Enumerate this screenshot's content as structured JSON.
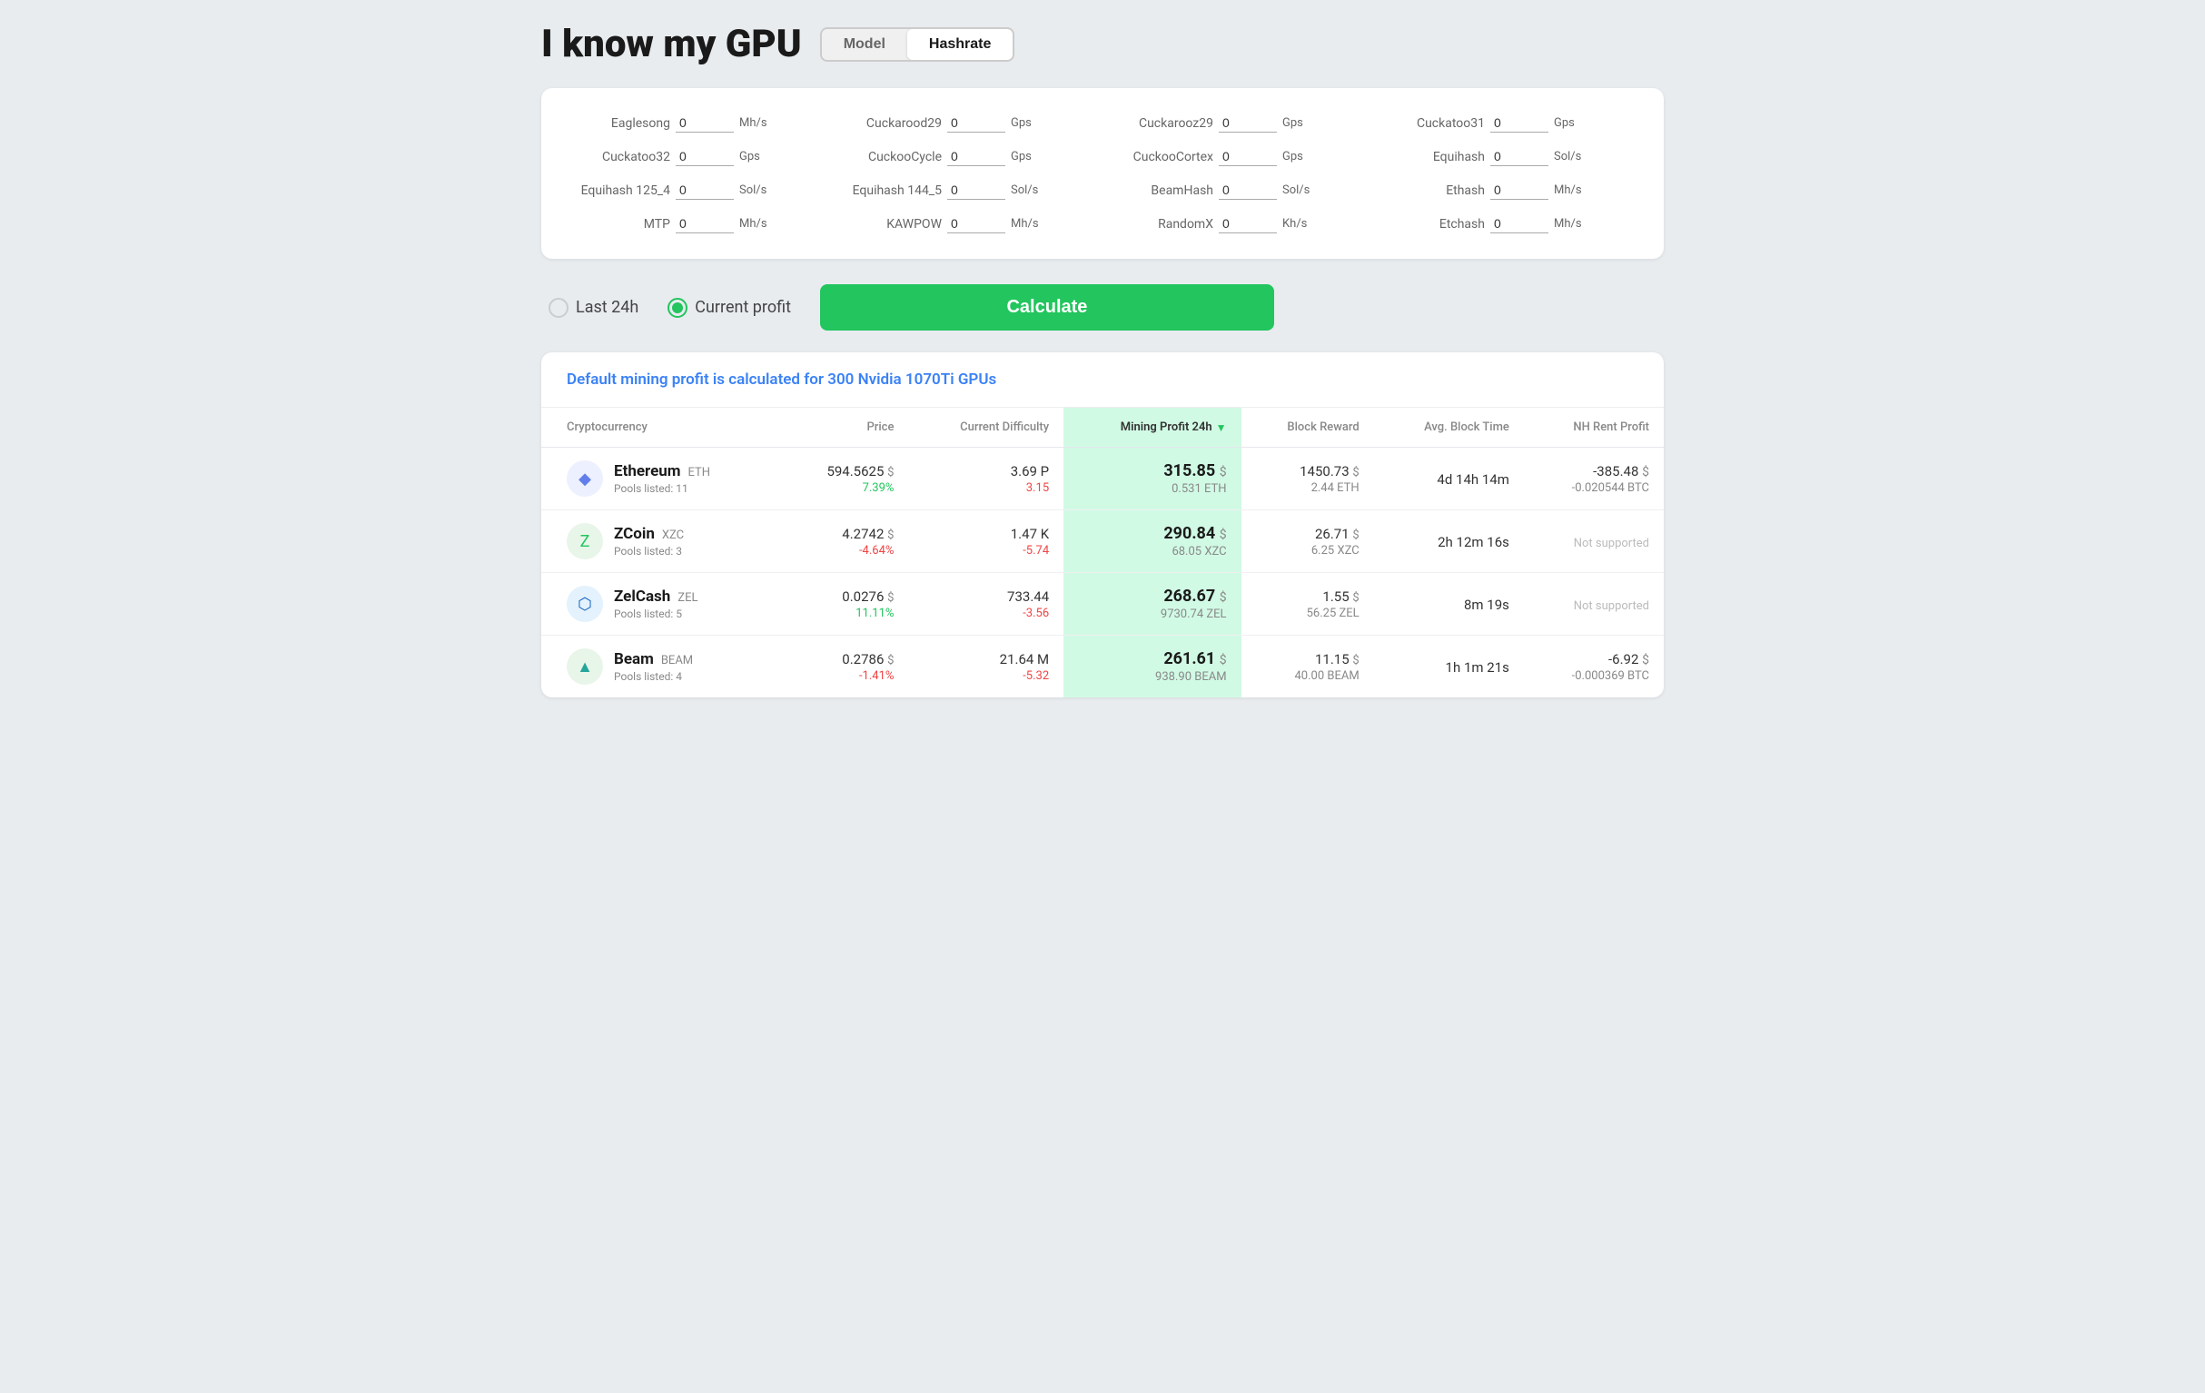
{
  "header": {
    "title": "I know my GPU",
    "mode_model_label": "Model",
    "mode_hashrate_label": "Hashrate",
    "active_mode": "Hashrate"
  },
  "hashrate_inputs": [
    {
      "label": "Eaglesong",
      "value": "0",
      "unit": "Mh/s"
    },
    {
      "label": "Cuckarood29",
      "value": "0",
      "unit": "Gps"
    },
    {
      "label": "Cuckarooz29",
      "value": "0",
      "unit": "Gps"
    },
    {
      "label": "Cuckatoo31",
      "value": "0",
      "unit": "Gps"
    },
    {
      "label": "Cuckatoo32",
      "value": "0",
      "unit": "Gps"
    },
    {
      "label": "CuckooCycle",
      "value": "0",
      "unit": "Gps"
    },
    {
      "label": "CuckooCortex",
      "value": "0",
      "unit": "Gps"
    },
    {
      "label": "Equihash",
      "value": "0",
      "unit": "Sol/s"
    },
    {
      "label": "Equihash 125_4",
      "value": "0",
      "unit": "Sol/s"
    },
    {
      "label": "Equihash 144_5",
      "value": "0",
      "unit": "Sol/s"
    },
    {
      "label": "BeamHash",
      "value": "0",
      "unit": "Sol/s"
    },
    {
      "label": "Ethash",
      "value": "0",
      "unit": "Mh/s"
    },
    {
      "label": "MTP",
      "value": "0",
      "unit": "Mh/s"
    },
    {
      "label": "KAWPOW",
      "value": "0",
      "unit": "Mh/s"
    },
    {
      "label": "RandomX",
      "value": "0",
      "unit": "Kh/s"
    },
    {
      "label": "Etchash",
      "value": "0",
      "unit": "Mh/s"
    }
  ],
  "controls": {
    "last24h_label": "Last 24h",
    "current_profit_label": "Current profit",
    "selected": "current_profit",
    "calculate_label": "Calculate"
  },
  "results": {
    "info_text": "Default mining profit is calculated for 300 Nvidia 1070Ti GPUs",
    "table_headers": {
      "cryptocurrency": "Cryptocurrency",
      "price": "Price",
      "difficulty": "Current Difficulty",
      "mining_profit": "Mining Profit 24h",
      "block_reward": "Block Reward",
      "avg_block_time": "Avg. Block Time",
      "nh_rent": "NH Rent Profit"
    },
    "rows": [
      {
        "icon_type": "eth",
        "icon_symbol": "◆",
        "name": "Ethereum",
        "ticker": "ETH",
        "pools": "Pools listed: 11",
        "price": "594.5625",
        "price_currency": "$",
        "price_change": "7.39%",
        "price_change_type": "positive",
        "difficulty": "3.69 P",
        "difficulty_change": "3.15",
        "profit_main": "315.85",
        "profit_currency": "$",
        "profit_sub": "0.531 ETH",
        "block_reward": "1450.73",
        "block_reward_currency": "$",
        "block_reward_sub": "2.44 ETH",
        "avg_block_time": "4d 14h 14m",
        "nh_rent": "-385.48",
        "nh_currency": "$",
        "nh_sub": "-0.020544 BTC"
      },
      {
        "icon_type": "xcz",
        "icon_symbol": "Z",
        "name": "ZCoin",
        "ticker": "XZC",
        "pools": "Pools listed: 3",
        "price": "4.2742",
        "price_currency": "$",
        "price_change": "-4.64%",
        "price_change_type": "negative",
        "difficulty": "1.47 K",
        "difficulty_change": "-5.74",
        "profit_main": "290.84",
        "profit_currency": "$",
        "profit_sub": "68.05 XZC",
        "block_reward": "26.71",
        "block_reward_currency": "$",
        "block_reward_sub": "6.25 XZC",
        "avg_block_time": "2h 12m 16s",
        "nh_rent": "Not supported",
        "nh_currency": "",
        "nh_sub": ""
      },
      {
        "icon_type": "zel",
        "icon_symbol": "⬡",
        "name": "ZelCash",
        "ticker": "ZEL",
        "pools": "Pools listed: 5",
        "price": "0.0276",
        "price_currency": "$",
        "price_change": "11.11%",
        "price_change_type": "positive",
        "difficulty": "733.44",
        "difficulty_change": "-3.56",
        "profit_main": "268.67",
        "profit_currency": "$",
        "profit_sub": "9730.74 ZEL",
        "block_reward": "1.55",
        "block_reward_currency": "$",
        "block_reward_sub": "56.25 ZEL",
        "avg_block_time": "8m 19s",
        "nh_rent": "Not supported",
        "nh_currency": "",
        "nh_sub": ""
      },
      {
        "icon_type": "beam",
        "icon_symbol": "▲",
        "name": "Beam",
        "ticker": "BEAM",
        "pools": "Pools listed: 4",
        "price": "0.2786",
        "price_currency": "$",
        "price_change": "-1.41%",
        "price_change_type": "negative",
        "difficulty": "21.64 M",
        "difficulty_change": "-5.32",
        "profit_main": "261.61",
        "profit_currency": "$",
        "profit_sub": "938.90 BEAM",
        "block_reward": "11.15",
        "block_reward_currency": "$",
        "block_reward_sub": "40.00 BEAM",
        "avg_block_time": "1h 1m 21s",
        "nh_rent": "-6.92",
        "nh_currency": "$",
        "nh_sub": "-0.000369 BTC"
      }
    ]
  }
}
